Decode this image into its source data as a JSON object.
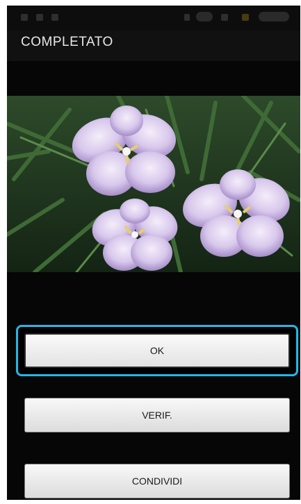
{
  "header": {
    "title": "COMPLETATO"
  },
  "photo": {
    "subject": "flower-photo"
  },
  "actions": {
    "ok_label": "OK",
    "verify_label": "VERIF.",
    "share_label": "CONDIVIDI"
  },
  "colors": {
    "focus_ring": "#28b6e6",
    "background": "#060606",
    "button_face": "#eeeeee"
  }
}
